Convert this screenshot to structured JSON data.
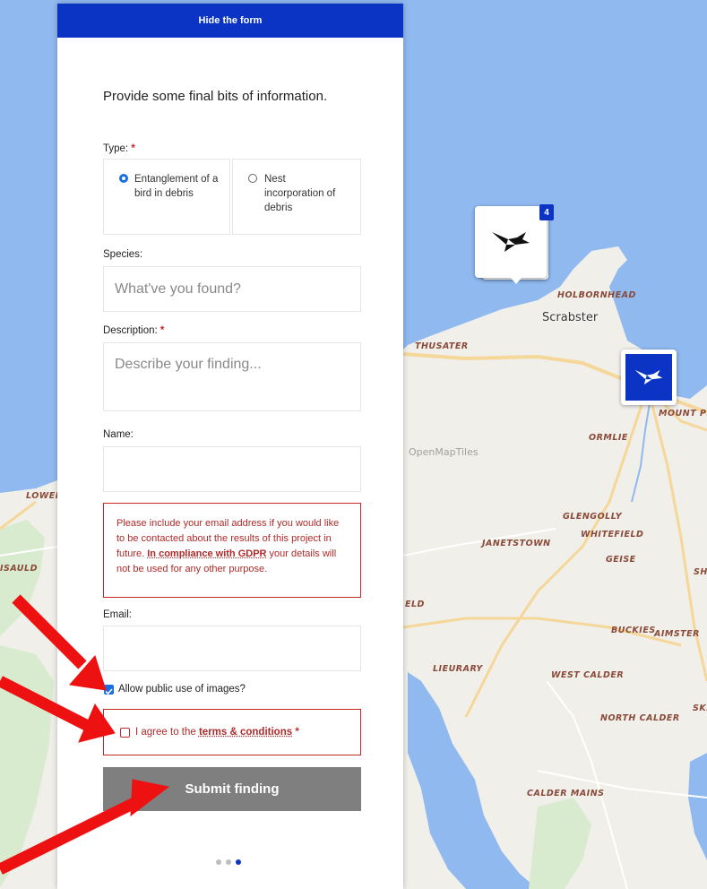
{
  "form": {
    "hide_label": "Hide the form",
    "intro": "Provide some final bits of information.",
    "type_label": "Type:",
    "required_mark": "*",
    "type_options": [
      {
        "label": "Entanglement of a bird in debris",
        "selected": true
      },
      {
        "label": "Nest incorporation of debris",
        "selected": false
      }
    ],
    "species_label": "Species:",
    "species_placeholder": "What've you found?",
    "description_label": "Description:",
    "description_placeholder": "Describe your finding...",
    "name_label": "Name:",
    "notice_part1": "Please include your email address if you would like to be contacted about the results of this project in future. ",
    "notice_link": "In compliance with GDPR",
    "notice_part2": " your details will not be used for any other purpose.",
    "email_label": "Email:",
    "public_images_label": "Allow public use of images?",
    "public_images_checked": true,
    "terms_prefix": "I agree to the ",
    "terms_link": "terms & conditions",
    "terms_checked": false,
    "submit_label": "Submit finding",
    "step_dots": 3,
    "active_step": 3
  },
  "map": {
    "labels": {
      "holbornhead": "HOLBORNHEAD",
      "scrabster": "Scrabster",
      "thusater": "THUSATER",
      "mount_pleasant": "MOUNT PLEASA",
      "ormlie": "ORMLIE",
      "openmaptiles": "OpenMapTiles",
      "lower": "LOWER I",
      "glengolly": "GLENGOLLY",
      "whitefield": "WHITEFIELD",
      "janetstown": "JANETSTOWN",
      "geise": "GEISE",
      "sh": "SH",
      "isauld": "ISAULD",
      "eld": "ELD",
      "buckies": "BUCKIES",
      "aimster": "AIMSTER",
      "lieurary": "LIEURARY",
      "west_calder": "WEST CALDER",
      "ski": "SKI",
      "north_calder": "NORTH CALDER",
      "calder_mains": "CALDER MAINS"
    },
    "cluster_count": "4"
  },
  "colors": {
    "accent": "#0b34c5",
    "required": "#c62828",
    "submit_bg": "#7f7f7f",
    "sea": "#8fb9ef",
    "arrow": "#ee1111"
  }
}
